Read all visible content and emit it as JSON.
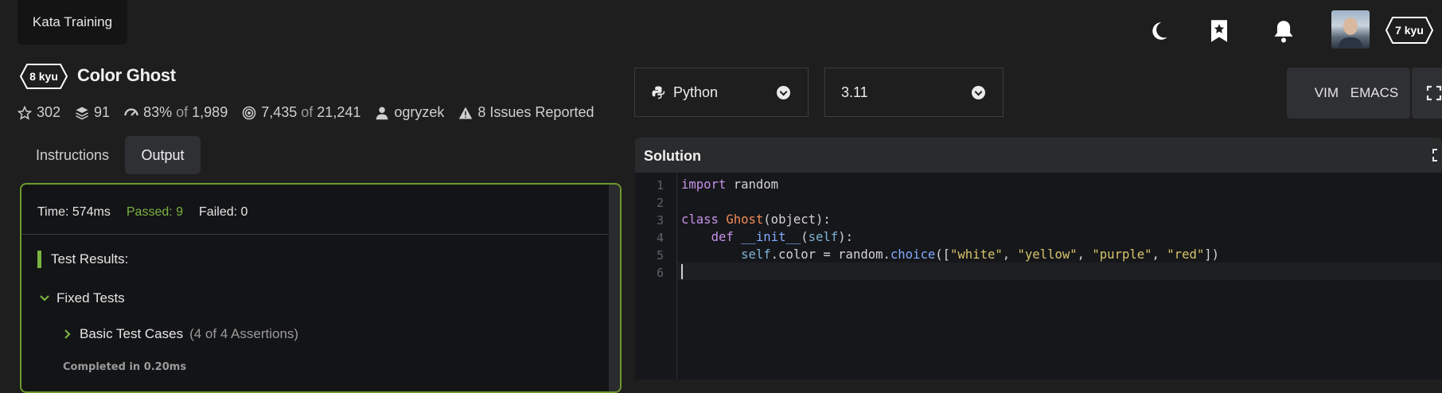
{
  "topbar": {
    "tab_label": "Kata Training",
    "user_rank": "7 kyu",
    "icons": [
      "moon-icon",
      "bookmark-star-icon",
      "bell-icon"
    ]
  },
  "kata": {
    "rank": "8 kyu",
    "title": "Color Ghost",
    "stats": {
      "stars": "302",
      "collections": "91",
      "satisfaction_pct": "83%",
      "satisfaction_of": "of",
      "satisfaction_votes": "1,989",
      "completed": "7,435",
      "completed_of": "of",
      "attempts": "21,241",
      "author": "ogryzek",
      "issues": "8 Issues Reported"
    }
  },
  "tabs": {
    "instructions": "Instructions",
    "output": "Output"
  },
  "output": {
    "time": "Time: 574ms",
    "passed": "Passed: 9",
    "failed": "Failed: 0",
    "results_heading": "Test Results:",
    "group": "Fixed Tests",
    "case": "Basic Test Cases",
    "case_assertions": "(4 of 4 Assertions)",
    "completed": "Completed in 0.20ms"
  },
  "editor": {
    "language": "Python",
    "version": "3.11",
    "vim_label": "VIM",
    "emacs_label": "EMACS",
    "solution_title": "Solution",
    "line_numbers": [
      "1",
      "2",
      "3",
      "4",
      "5",
      "6"
    ],
    "code": {
      "l1_kw": "import",
      "l1_rest": " random",
      "l3_kw": "class",
      "l3_cls": "Ghost",
      "l3_rest": "(object):",
      "l4_kw": "def",
      "l4_fn": "__init__",
      "l4_p1": "(",
      "l4_self": "self",
      "l4_p2": "):",
      "l5_self": "self",
      "l5_a": ".color = random.",
      "l5_fn": "choice",
      "l5_b": "([",
      "l5_s1": "\"white\"",
      "l5_c1": ", ",
      "l5_s2": "\"yellow\"",
      "l5_c2": ", ",
      "l5_s3": "\"purple\"",
      "l5_c3": ", ",
      "l5_s4": "\"red\"",
      "l5_end": "])"
    }
  },
  "colors": {
    "background": "#1e1e1e",
    "pass_green": "#7bb342",
    "panel_border": "#6d9a2e"
  }
}
